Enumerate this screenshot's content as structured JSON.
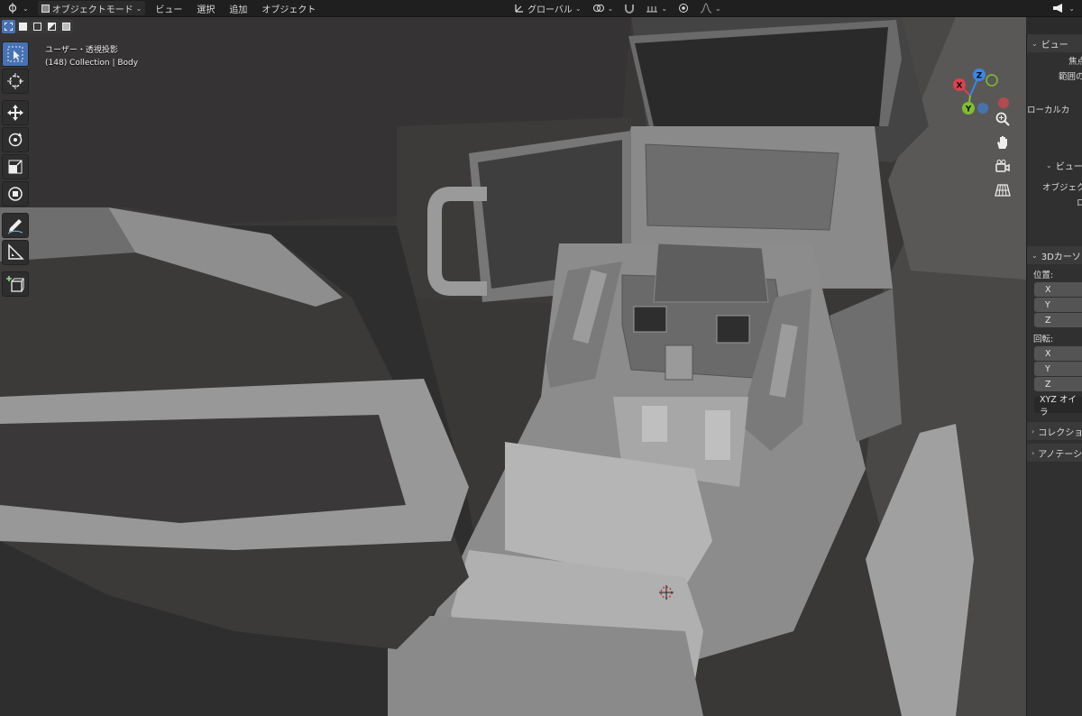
{
  "header": {
    "mode_label": "オブジェクトモード",
    "menus": [
      "ビュー",
      "選択",
      "追加",
      "オブジェクト"
    ],
    "orientation_label": "グローバル"
  },
  "viewport": {
    "view_name": "ユーザー・透視投影",
    "collection_info": "(148) Collection | Body"
  },
  "gizmo": {
    "axis_x": "X",
    "axis_y": "Y",
    "axis_z": "Z",
    "color_x": "#d8434f",
    "color_y": "#7fbf2f",
    "color_z": "#3b86e6"
  },
  "toolbar": {
    "tools": [
      "select-box",
      "cursor",
      "move",
      "rotate",
      "scale",
      "transform",
      "annotate",
      "measure",
      "add-cube"
    ]
  },
  "npanel": {
    "view_section": "ビュー",
    "focal_label": "焦点",
    "clip_label": "範囲の",
    "local_camera_label": "ローカルカ",
    "view_lock_section": "ビュー",
    "object_label": "オブジェク",
    "lock_label": "ロ",
    "cursor_section": "3Dカーソ",
    "location_label": "位置:",
    "x": "X",
    "y": "Y",
    "z": "Z",
    "rotation_label": "回転:",
    "rot_x": "X",
    "rot_y": "Y",
    "rot_z": "Z",
    "rotation_mode": "XYZ オイラ",
    "collection_section": "コレクショ",
    "annotation_section": "アノテーシ"
  },
  "colors": {
    "accent": "#4772b3",
    "header_bg": "#1f1f1f",
    "panel_bg": "#303030"
  }
}
